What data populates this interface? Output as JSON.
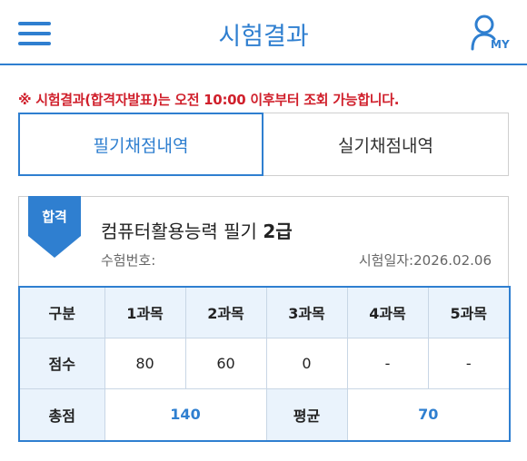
{
  "header": {
    "title": "시험결과",
    "my_label": "MY"
  },
  "notice": {
    "prefix": "※ 시험결과(합격자발표)는 오전 ",
    "time": "10:00",
    "suffix": " 이후부터 조회 가능합니다."
  },
  "tabs": [
    {
      "label": "필기채점내역",
      "active": true
    },
    {
      "label": "실기채점내역",
      "active": false
    }
  ],
  "result": {
    "status": "합격",
    "exam_name_text": "컴퓨터활용능력 필기 ",
    "exam_grade": "2급",
    "exam_no_label": "수험번호:",
    "exam_date_label": "시험일자:",
    "exam_date": "2026.02.06"
  },
  "table": {
    "headers": [
      "구분",
      "1과목",
      "2과목",
      "3과목",
      "4과목",
      "5과목"
    ],
    "score_row": [
      "점수",
      "80",
      "60",
      "0",
      "-",
      "-"
    ],
    "total_label": "총점",
    "total_value": "140",
    "average_label": "평균",
    "average_value": "70"
  },
  "colors": {
    "accent": "#2f7fd0",
    "notice": "#d0202c",
    "header_cell": "#eaf3fc"
  }
}
